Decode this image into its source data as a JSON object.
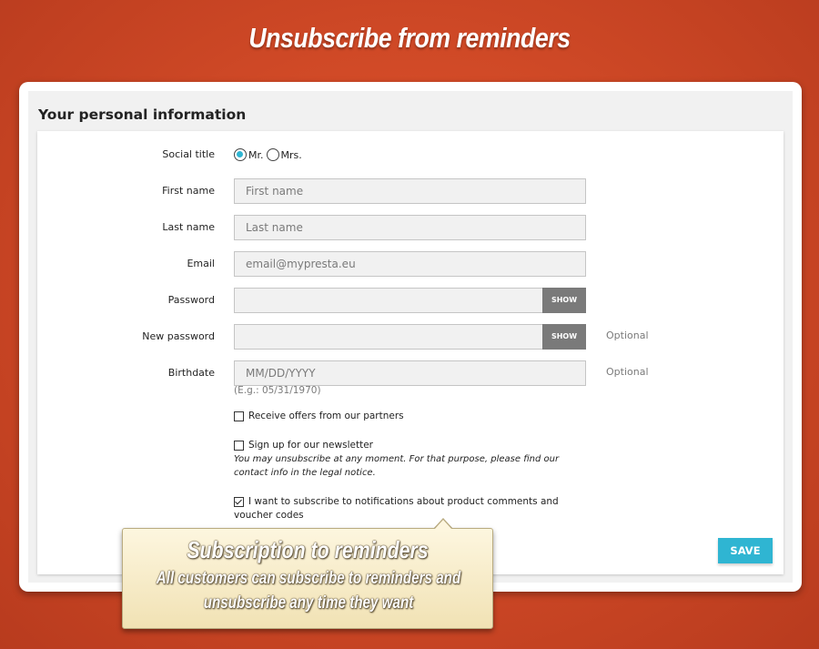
{
  "banner": {
    "title": "Unsubscribe from reminders"
  },
  "section": {
    "title": "Your personal information"
  },
  "form": {
    "social_title": {
      "label": "Social title",
      "options": [
        "Mr.",
        "Mrs."
      ],
      "selected": "Mr."
    },
    "first_name": {
      "label": "First name",
      "placeholder": "First name"
    },
    "last_name": {
      "label": "Last name",
      "placeholder": "Last name"
    },
    "email": {
      "label": "Email",
      "placeholder": "email@mypresta.eu"
    },
    "password": {
      "label": "Password",
      "show_label": "SHOW"
    },
    "new_password": {
      "label": "New password",
      "show_label": "SHOW",
      "optional": "Optional"
    },
    "birthdate": {
      "label": "Birthdate",
      "placeholder": "MM/DD/YYYY",
      "optional": "Optional",
      "hint": "(E.g.: 05/31/1970)"
    },
    "partner_offers": {
      "label": "Receive offers from our partners",
      "checked": false
    },
    "newsletter": {
      "label": "Sign up for our newsletter",
      "note": "You may unsubscribe at any moment. For that purpose, please find our contact info in the legal notice.",
      "checked": false
    },
    "notifications": {
      "label": "I want to subscribe to notifications about product comments and voucher codes",
      "checked": true
    },
    "save_label": "SAVE"
  },
  "callout": {
    "title": "Subscription to reminders",
    "body": "All customers can subscribe to reminders and unsubscribe any time  they want"
  },
  "colors": {
    "accent": "#2fb5d2",
    "background": "#d14a27",
    "show_button": "#7a7a7a"
  }
}
